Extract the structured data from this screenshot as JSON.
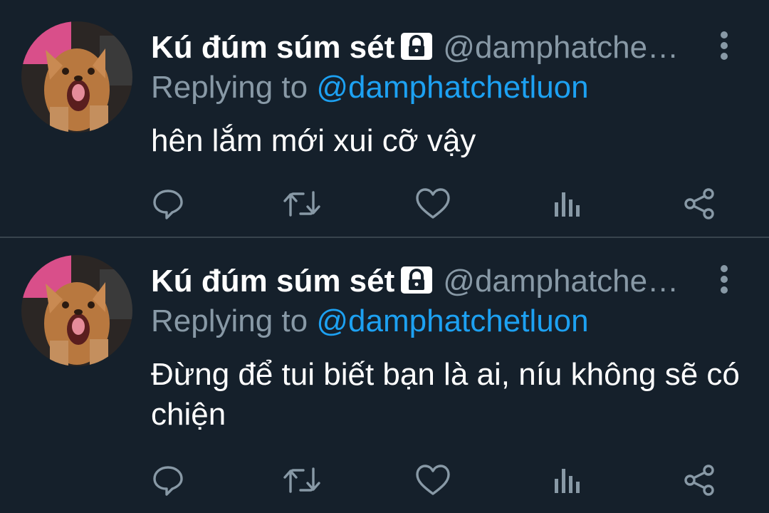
{
  "tweets": [
    {
      "display_name": "Kú đúm súm sét",
      "handle": "@damphatche…",
      "replying_prefix": "Replying to",
      "replying_to": "@damphatchetluon",
      "text": "hên lắm mới xui cỡ vậy",
      "protected_icon": "lock-icon",
      "actions": [
        "reply-icon",
        "retweet-icon",
        "like-icon",
        "analytics-icon",
        "share-icon"
      ]
    },
    {
      "display_name": "Kú đúm súm sét",
      "handle": "@damphatche…",
      "replying_prefix": "Replying to",
      "replying_to": "@damphatchetluon",
      "text": "Đừng để tui biết bạn là ai, níu không sẽ có chiện",
      "protected_icon": "lock-icon",
      "actions": [
        "reply-icon",
        "retweet-icon",
        "like-icon",
        "analytics-icon",
        "share-icon"
      ]
    }
  ],
  "colors": {
    "background": "#15202b",
    "divider": "#38444d",
    "primary_text": "#ffffff",
    "secondary_text": "#8899a6",
    "accent": "#1da1f2"
  }
}
